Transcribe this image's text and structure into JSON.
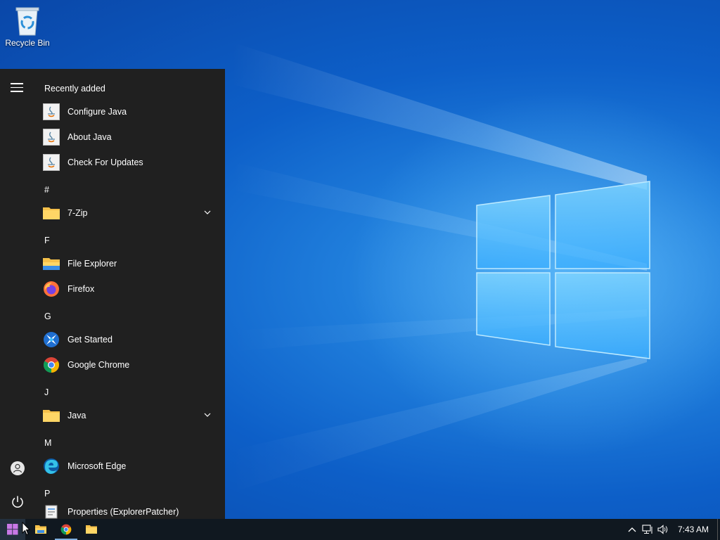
{
  "desktop": {
    "icons": [
      {
        "label": "Recycle Bin",
        "icon": "recycle-bin-icon"
      }
    ]
  },
  "start_menu": {
    "recently_added_header": "Recently added",
    "recent": [
      {
        "label": "Configure Java",
        "icon": "java-icon"
      },
      {
        "label": "About Java",
        "icon": "java-icon"
      },
      {
        "label": "Check For Updates",
        "icon": "java-icon"
      }
    ],
    "groups": [
      {
        "letter": "#",
        "items": [
          {
            "label": "7-Zip",
            "icon": "folder-icon",
            "expandable": true
          }
        ]
      },
      {
        "letter": "F",
        "items": [
          {
            "label": "File Explorer",
            "icon": "file-explorer-icon"
          },
          {
            "label": "Firefox",
            "icon": "firefox-icon"
          }
        ]
      },
      {
        "letter": "G",
        "items": [
          {
            "label": "Get Started",
            "icon": "get-started-icon"
          },
          {
            "label": "Google Chrome",
            "icon": "chrome-icon"
          }
        ]
      },
      {
        "letter": "J",
        "items": [
          {
            "label": "Java",
            "icon": "folder-icon",
            "expandable": true
          }
        ]
      },
      {
        "letter": "M",
        "items": [
          {
            "label": "Microsoft Edge",
            "icon": "edge-icon"
          }
        ]
      },
      {
        "letter": "P",
        "items": [
          {
            "label": "Properties (ExplorerPatcher)",
            "icon": "properties-icon"
          }
        ]
      }
    ]
  },
  "taskbar": {
    "pinned": [
      "file-explorer-icon",
      "chrome-icon",
      "folder-icon"
    ],
    "tray": {
      "clock": "7:43 AM"
    }
  },
  "colors": {
    "menu_bg": "#202020",
    "taskbar_bg": "#101820",
    "desktop_accent": "#1f7ddb"
  }
}
